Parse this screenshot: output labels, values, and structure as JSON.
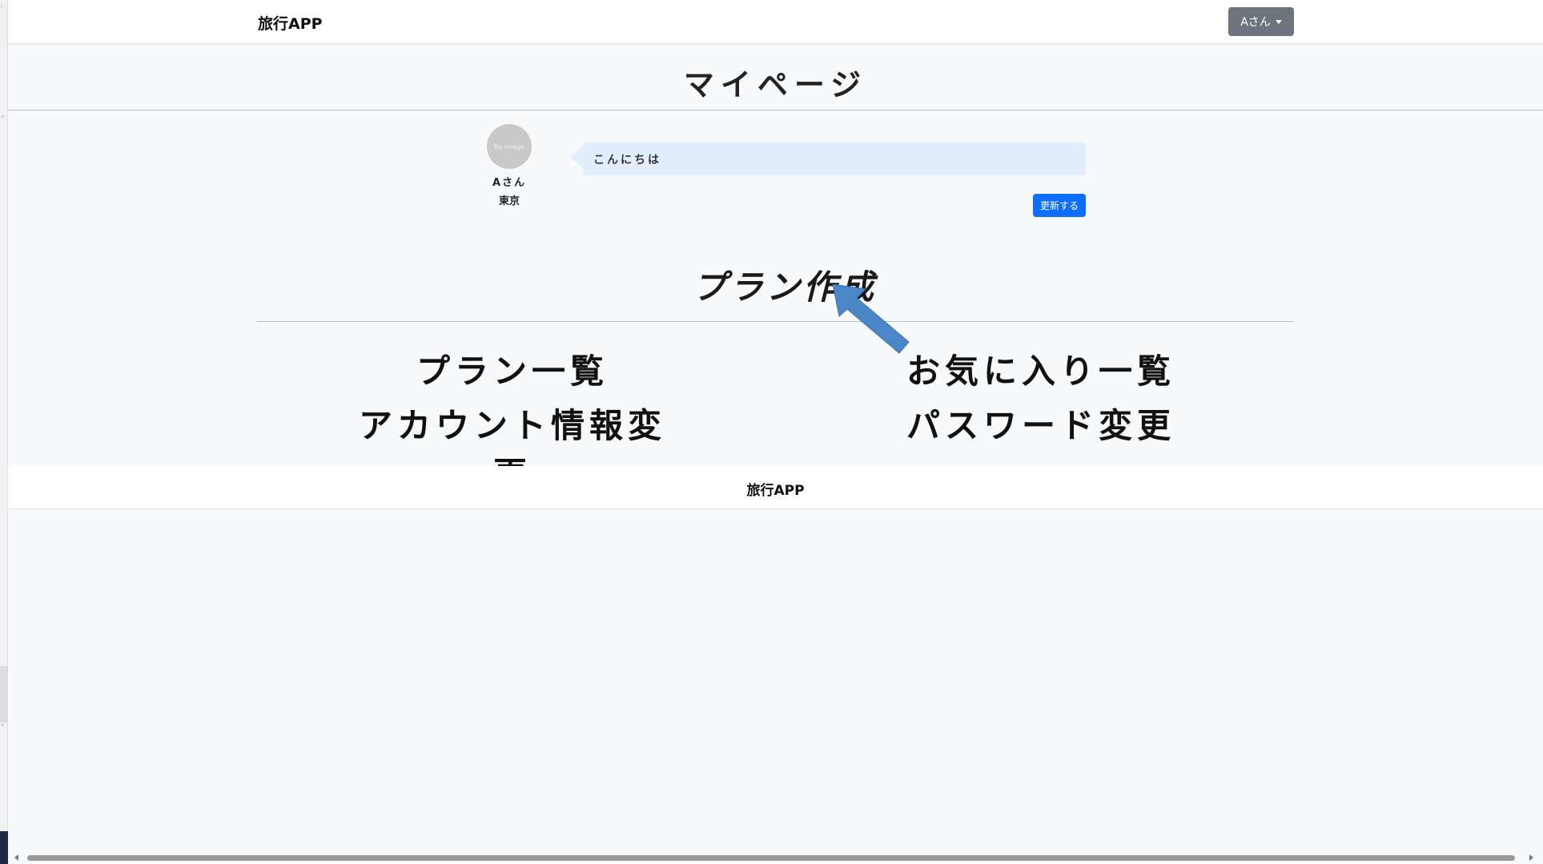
{
  "navbar": {
    "brand": "旅行APP",
    "user_menu_label": "Aさん"
  },
  "page": {
    "title": "マイページ"
  },
  "profile": {
    "avatar_text": "No image",
    "name": "Aさん",
    "location": "東京",
    "message": "こんにちは",
    "update_button": "更新する"
  },
  "plan_create": {
    "label": "プラン作成"
  },
  "menu": {
    "plan_list": "プラン一覧",
    "favorites": "お気に入り一覧",
    "account_edit": "アカウント情報変更",
    "password_edit": "パスワード変更"
  },
  "footer": {
    "brand": "旅行APP"
  },
  "colors": {
    "primary": "#0d6efd",
    "secondary": "#6c757d",
    "bubble": "#e2eefc",
    "annotation_arrow": "#4a86c8"
  },
  "icons": {
    "dropdown": "caret-down-icon",
    "annotation": "arrow-pointer-icon"
  }
}
